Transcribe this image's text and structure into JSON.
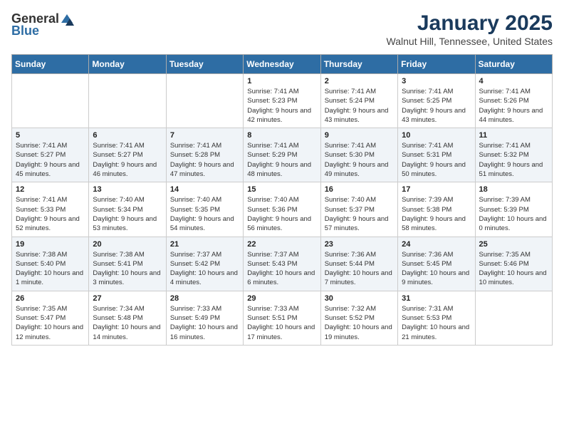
{
  "header": {
    "logo_general": "General",
    "logo_blue": "Blue",
    "month": "January 2025",
    "location": "Walnut Hill, Tennessee, United States"
  },
  "weekdays": [
    "Sunday",
    "Monday",
    "Tuesday",
    "Wednesday",
    "Thursday",
    "Friday",
    "Saturday"
  ],
  "weeks": [
    [
      {
        "day": "",
        "info": ""
      },
      {
        "day": "",
        "info": ""
      },
      {
        "day": "",
        "info": ""
      },
      {
        "day": "1",
        "info": "Sunrise: 7:41 AM\nSunset: 5:23 PM\nDaylight: 9 hours and 42 minutes."
      },
      {
        "day": "2",
        "info": "Sunrise: 7:41 AM\nSunset: 5:24 PM\nDaylight: 9 hours and 43 minutes."
      },
      {
        "day": "3",
        "info": "Sunrise: 7:41 AM\nSunset: 5:25 PM\nDaylight: 9 hours and 43 minutes."
      },
      {
        "day": "4",
        "info": "Sunrise: 7:41 AM\nSunset: 5:26 PM\nDaylight: 9 hours and 44 minutes."
      }
    ],
    [
      {
        "day": "5",
        "info": "Sunrise: 7:41 AM\nSunset: 5:27 PM\nDaylight: 9 hours and 45 minutes."
      },
      {
        "day": "6",
        "info": "Sunrise: 7:41 AM\nSunset: 5:27 PM\nDaylight: 9 hours and 46 minutes."
      },
      {
        "day": "7",
        "info": "Sunrise: 7:41 AM\nSunset: 5:28 PM\nDaylight: 9 hours and 47 minutes."
      },
      {
        "day": "8",
        "info": "Sunrise: 7:41 AM\nSunset: 5:29 PM\nDaylight: 9 hours and 48 minutes."
      },
      {
        "day": "9",
        "info": "Sunrise: 7:41 AM\nSunset: 5:30 PM\nDaylight: 9 hours and 49 minutes."
      },
      {
        "day": "10",
        "info": "Sunrise: 7:41 AM\nSunset: 5:31 PM\nDaylight: 9 hours and 50 minutes."
      },
      {
        "day": "11",
        "info": "Sunrise: 7:41 AM\nSunset: 5:32 PM\nDaylight: 9 hours and 51 minutes."
      }
    ],
    [
      {
        "day": "12",
        "info": "Sunrise: 7:41 AM\nSunset: 5:33 PM\nDaylight: 9 hours and 52 minutes."
      },
      {
        "day": "13",
        "info": "Sunrise: 7:40 AM\nSunset: 5:34 PM\nDaylight: 9 hours and 53 minutes."
      },
      {
        "day": "14",
        "info": "Sunrise: 7:40 AM\nSunset: 5:35 PM\nDaylight: 9 hours and 54 minutes."
      },
      {
        "day": "15",
        "info": "Sunrise: 7:40 AM\nSunset: 5:36 PM\nDaylight: 9 hours and 56 minutes."
      },
      {
        "day": "16",
        "info": "Sunrise: 7:40 AM\nSunset: 5:37 PM\nDaylight: 9 hours and 57 minutes."
      },
      {
        "day": "17",
        "info": "Sunrise: 7:39 AM\nSunset: 5:38 PM\nDaylight: 9 hours and 58 minutes."
      },
      {
        "day": "18",
        "info": "Sunrise: 7:39 AM\nSunset: 5:39 PM\nDaylight: 10 hours and 0 minutes."
      }
    ],
    [
      {
        "day": "19",
        "info": "Sunrise: 7:38 AM\nSunset: 5:40 PM\nDaylight: 10 hours and 1 minute."
      },
      {
        "day": "20",
        "info": "Sunrise: 7:38 AM\nSunset: 5:41 PM\nDaylight: 10 hours and 3 minutes."
      },
      {
        "day": "21",
        "info": "Sunrise: 7:37 AM\nSunset: 5:42 PM\nDaylight: 10 hours and 4 minutes."
      },
      {
        "day": "22",
        "info": "Sunrise: 7:37 AM\nSunset: 5:43 PM\nDaylight: 10 hours and 6 minutes."
      },
      {
        "day": "23",
        "info": "Sunrise: 7:36 AM\nSunset: 5:44 PM\nDaylight: 10 hours and 7 minutes."
      },
      {
        "day": "24",
        "info": "Sunrise: 7:36 AM\nSunset: 5:45 PM\nDaylight: 10 hours and 9 minutes."
      },
      {
        "day": "25",
        "info": "Sunrise: 7:35 AM\nSunset: 5:46 PM\nDaylight: 10 hours and 10 minutes."
      }
    ],
    [
      {
        "day": "26",
        "info": "Sunrise: 7:35 AM\nSunset: 5:47 PM\nDaylight: 10 hours and 12 minutes."
      },
      {
        "day": "27",
        "info": "Sunrise: 7:34 AM\nSunset: 5:48 PM\nDaylight: 10 hours and 14 minutes."
      },
      {
        "day": "28",
        "info": "Sunrise: 7:33 AM\nSunset: 5:49 PM\nDaylight: 10 hours and 16 minutes."
      },
      {
        "day": "29",
        "info": "Sunrise: 7:33 AM\nSunset: 5:51 PM\nDaylight: 10 hours and 17 minutes."
      },
      {
        "day": "30",
        "info": "Sunrise: 7:32 AM\nSunset: 5:52 PM\nDaylight: 10 hours and 19 minutes."
      },
      {
        "day": "31",
        "info": "Sunrise: 7:31 AM\nSunset: 5:53 PM\nDaylight: 10 hours and 21 minutes."
      },
      {
        "day": "",
        "info": ""
      }
    ]
  ]
}
